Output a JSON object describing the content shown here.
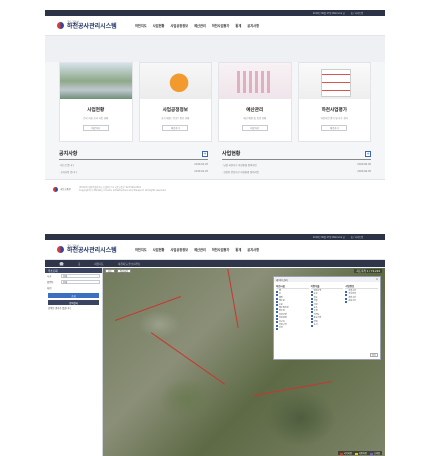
{
  "site": {
    "logo_sub": "국토교통부",
    "logo_main": "하천공사관리시스템",
    "top_links": [
      "2019년 06월 27일 Welcome 님",
      "홈 / 사이트맵"
    ],
    "gnb": [
      "하천지도",
      "사업현황",
      "사업공정정보",
      "예산관리",
      "하천사업평가",
      "통계",
      "공지사항"
    ]
  },
  "cards": [
    {
      "title": "사업현황",
      "desc": "전국 하천 공사 사업 현황",
      "btn": "바로가기"
    },
    {
      "title": "사업공정정보",
      "desc": "공사 예정 / 진행 / 완료 현황",
      "btn": "바로가기"
    },
    {
      "title": "예산관리",
      "desc": "예산 배정 및 집행 현황",
      "btn": "바로가기"
    },
    {
      "title": "하천사업평가",
      "desc": "하천사업 평가 및 사후 관리",
      "btn": "바로가기"
    }
  ],
  "boards": {
    "notice": {
      "title": "공지사항",
      "plus": "+",
      "rows": [
        {
          "text": "· 테스트입니다",
          "date": "2019.02.25"
        },
        {
          "text": "· 공지사항 입니다",
          "date": "2019.02.25"
        }
      ]
    },
    "status": {
      "title": "사업현황",
      "plus": "+",
      "rows": [
        {
          "text": "· 남강 하천지구 하천환경 정비사업",
          "date": "2020.06.05"
        },
        {
          "text": "· 한탄천 민천지구 하천환경 정비사업",
          "date": "2020.06.05"
        }
      ]
    }
  },
  "footer": {
    "logo": "국토교통부",
    "line1": "(30103) 세종특별자치시 도움6로 11 국토교통부 Tel 1599-0001",
    "line2": "Copyright (c) Ministry of Land, Infrastructure and Transport. All Rights reserved."
  },
  "map_page": {
    "nav_home": "홈",
    "nav": [
      "하천지도",
      "하천지도(주소/지역)"
    ],
    "side": {
      "title": "주소조회",
      "rows": [
        {
          "label": "시군",
          "value": "전체"
        },
        {
          "label": "읍면동",
          "value": "전체"
        },
        {
          "label": "하천",
          "value": ""
        }
      ],
      "search_btn": "조회",
      "result_title": "검색결과",
      "result_text": "검색된 결과가 없습니다"
    },
    "tools": [
      "지도",
      "항공사진"
    ],
    "stats": "지도축척 1 / 72,224",
    "layer_panel": {
      "title": "레이어 관리",
      "close_label": "닫기",
      "cols": [
        {
          "title": "하천시설",
          "items": [
            {
              "label": "댐",
              "on": true
            },
            {
              "label": "보",
              "on": true
            },
            {
              "label": "제방",
              "on": true
            },
            {
              "label": "배수문",
              "on": true
            },
            {
              "label": "수문",
              "on": true
            },
            {
              "label": "배수펌프장",
              "on": true
            },
            {
              "label": "취수장",
              "on": true
            },
            {
              "label": "하천교량",
              "on": true
            },
            {
              "label": "하천경계",
              "on": true
            },
            {
              "label": "하구둑",
              "on": true
            },
            {
              "label": "하천구역",
              "on": true
            },
            {
              "label": "기타",
              "on": true
            }
          ]
        },
        {
          "title": "지형지물",
          "items": [
            {
              "label": "행정구역",
              "on": true
            },
            {
              "label": "도로",
              "on": true
            },
            {
              "label": "철도",
              "on": true
            },
            {
              "label": "건물",
              "on": true
            },
            {
              "label": "하천",
              "on": true
            },
            {
              "label": "호소",
              "on": true
            },
            {
              "label": "수계",
              "on": true
            },
            {
              "label": "지적도",
              "on": false
            },
            {
              "label": "용도지역",
              "on": false
            },
            {
              "label": "산림",
              "on": false
            },
            {
              "label": "농지",
              "on": false
            }
          ]
        },
        {
          "title": "사업정보",
          "items": [
            {
              "label": "사업구간",
              "on": true
            },
            {
              "label": "공사현황",
              "on": true
            },
            {
              "label": "계획구간",
              "on": false
            },
            {
              "label": "완료구간",
              "on": false
            }
          ]
        }
      ]
    },
    "legend": [
      {
        "label": "국가하천",
        "color": "#d9352e"
      },
      {
        "label": "지방하천",
        "color": "#f0c419"
      },
      {
        "label": "소하천",
        "color": "#7b5cd6"
      }
    ]
  }
}
